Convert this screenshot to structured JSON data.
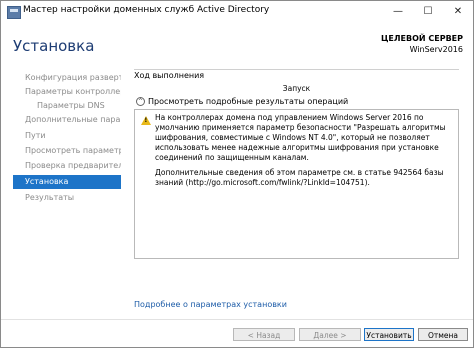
{
  "window": {
    "title": "Мастер настройки доменных служб Active Directory",
    "minimize": "—",
    "maximize": "☐",
    "close": "✕"
  },
  "header": {
    "page_title": "Установка",
    "target_label": "ЦЕЛЕВОЙ СЕРВЕР",
    "target_name": "WinServ2016"
  },
  "sidebar": {
    "items": [
      {
        "label": "Конфигурация разверты...",
        "state": "disabled"
      },
      {
        "label": "Параметры контроллера...",
        "state": "disabled"
      },
      {
        "label": "Параметры DNS",
        "state": "disabled"
      },
      {
        "label": "Дополнительные парам...",
        "state": "disabled"
      },
      {
        "label": "Пути",
        "state": "disabled"
      },
      {
        "label": "Просмотреть параметры",
        "state": "disabled"
      },
      {
        "label": "Проверка предварительн...",
        "state": "disabled"
      },
      {
        "label": "Установка",
        "state": "active"
      },
      {
        "label": "Результаты",
        "state": "disabled"
      }
    ]
  },
  "main": {
    "progress_label": "Ход выполнения",
    "launch_status": "Запуск",
    "details_toggle": "Просмотреть подробные результаты операций",
    "warning_text": "На контроллерах домена под управлением Windows Server 2016 по умолчанию применяется параметр безопасности \"Разрешать алгоритмы шифрования, совместимые с Windows NT 4.0\", который не позволяет использовать менее надежные алгоритмы шифрования при установке соединений по защищенным каналам.",
    "warning_more": "Дополнительные сведения об этом параметре см. в статье 942564 базы знаний (http://go.microsoft.com/fwlink/?LinkId=104751).",
    "more_link": "Подробнее о параметрах установки",
    "warning_icon": "warning-icon"
  },
  "footer": {
    "back": "< Назад",
    "next": "Далее >",
    "install": "Установить",
    "cancel": "Отмена"
  }
}
